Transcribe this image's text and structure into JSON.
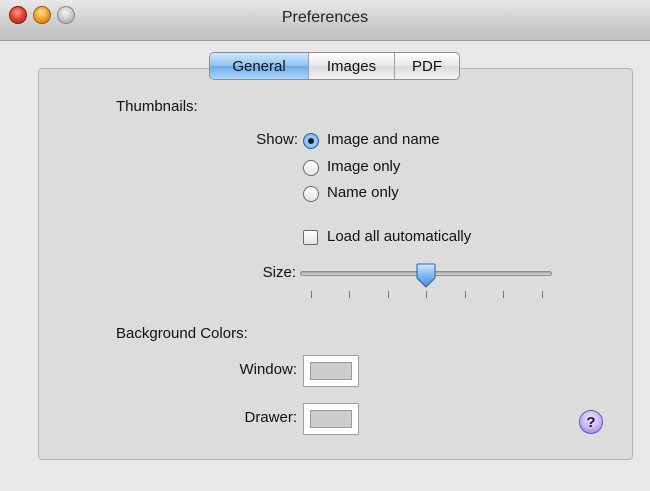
{
  "window": {
    "title": "Preferences"
  },
  "tabs": [
    {
      "label": "General",
      "selected": true
    },
    {
      "label": "Images",
      "selected": false
    },
    {
      "label": "PDF",
      "selected": false
    }
  ],
  "thumbnails": {
    "heading": "Thumbnails:",
    "show_label": "Show:",
    "options": [
      {
        "label": "Image and name",
        "selected": true
      },
      {
        "label": "Image only",
        "selected": false
      },
      {
        "label": "Name only",
        "selected": false
      }
    ],
    "load_all": {
      "label": "Load all automatically",
      "checked": false
    },
    "size_label": "Size:",
    "size_fraction": 0.5,
    "tick_count": 7
  },
  "background_colors": {
    "heading": "Background Colors:",
    "window_label": "Window:",
    "window_color": "#cccccc",
    "drawer_label": "Drawer:",
    "drawer_color": "#cccccc"
  },
  "help": {
    "glyph": "?",
    "icon": "help-icon"
  }
}
